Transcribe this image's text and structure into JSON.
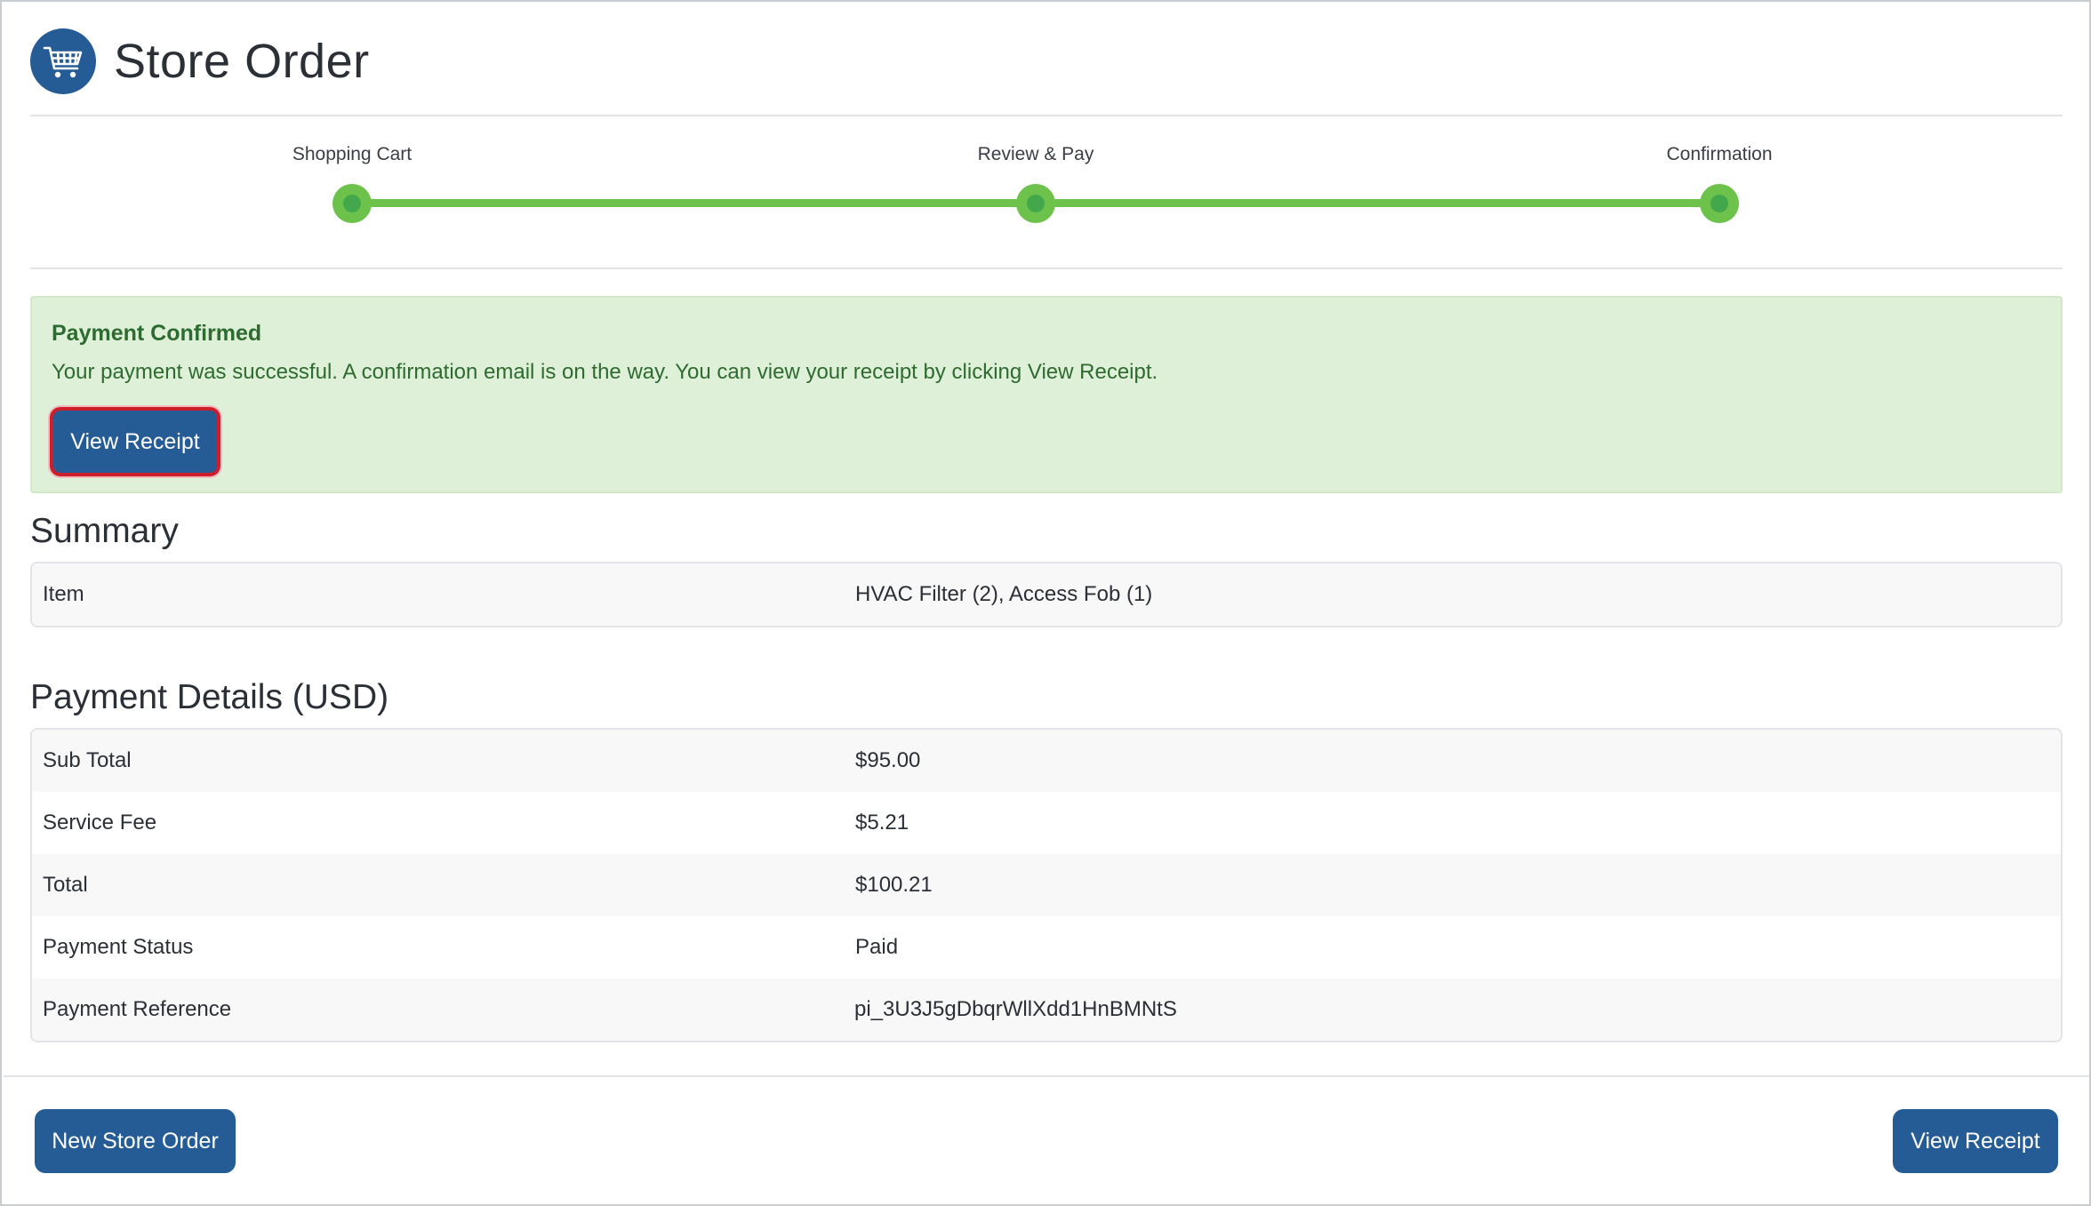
{
  "header": {
    "title": "Store Order",
    "icon": "shopping-cart-icon",
    "icon_bg": "#255c95"
  },
  "stepper": {
    "steps": [
      {
        "label": "Shopping Cart",
        "complete": true
      },
      {
        "label": "Review & Pay",
        "complete": true
      },
      {
        "label": "Confirmation",
        "complete": true
      }
    ],
    "color": "#6cc24a"
  },
  "alert": {
    "title": "Payment Confirmed",
    "message": "Your payment was successful. A confirmation email is on the way. You can view your receipt by clicking View Receipt.",
    "button_label": "View Receipt",
    "bg": "#dff0d8"
  },
  "summary": {
    "title": "Summary",
    "rows": [
      {
        "label": "Item",
        "value": "HVAC Filter (2), Access Fob (1)"
      }
    ]
  },
  "payment": {
    "title": "Payment Details (USD)",
    "rows": [
      {
        "label": "Sub Total",
        "value": "$95.00"
      },
      {
        "label": "Service Fee",
        "value": "$5.21"
      },
      {
        "label": "Total",
        "value": "$100.21"
      },
      {
        "label": "Payment Status",
        "value": "Paid"
      },
      {
        "label": "Payment Reference",
        "value": "pi_3U3J5gDbqrWllXdd1HnBMNtS"
      }
    ]
  },
  "footer": {
    "new_order_label": "New Store Order",
    "view_receipt_label": "View Receipt"
  },
  "colors": {
    "primary": "#255c95",
    "highlight": "#cc1f2b"
  }
}
